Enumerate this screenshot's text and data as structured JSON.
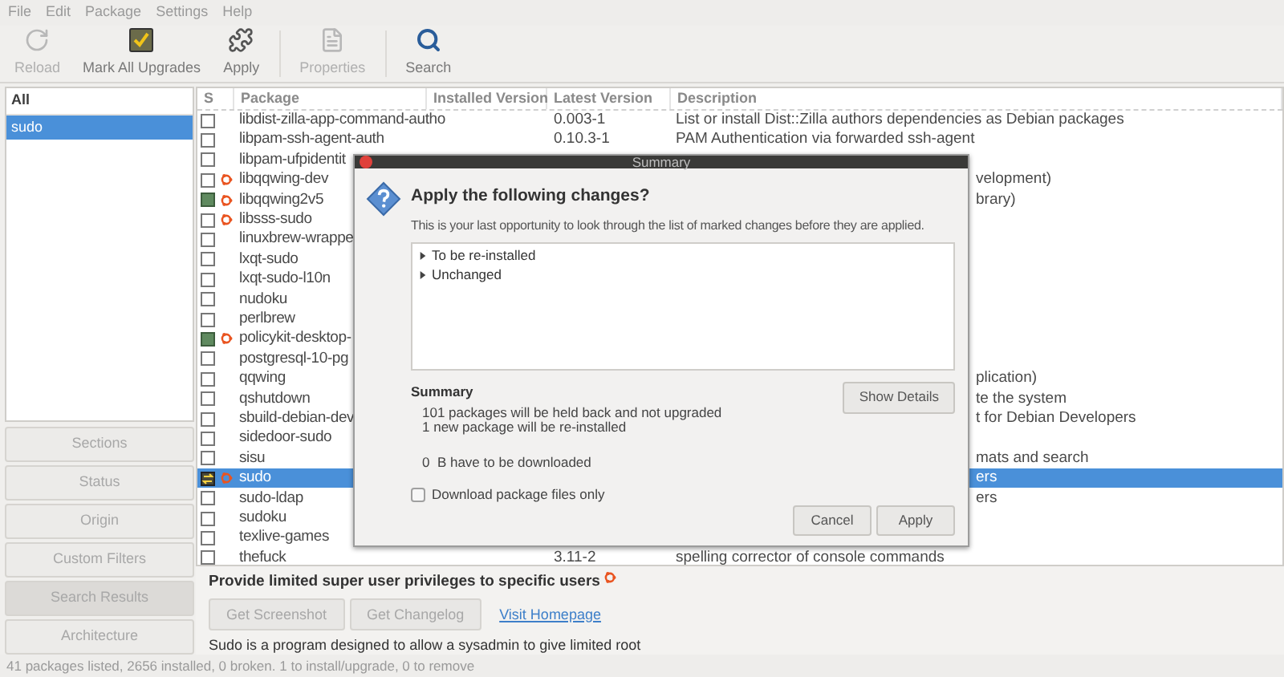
{
  "menu": [
    "File",
    "Edit",
    "Package",
    "Settings",
    "Help"
  ],
  "toolbar": [
    [
      {
        "label": "Reload",
        "kind": "reload",
        "disabled": true
      },
      {
        "label": "Mark All Upgrades",
        "kind": "mark",
        "disabled": false
      },
      {
        "label": "Apply",
        "kind": "apply",
        "disabled": false
      }
    ],
    [
      {
        "label": "Properties",
        "kind": "properties",
        "disabled": true
      }
    ],
    [
      {
        "label": "Search",
        "kind": "search",
        "disabled": false
      }
    ]
  ],
  "filter_list": {
    "header": "All",
    "items": [
      {
        "label": "sudo",
        "selected": true
      }
    ]
  },
  "filter_buttons": [
    {
      "label": "Sections",
      "selected": false
    },
    {
      "label": "Status",
      "selected": false
    },
    {
      "label": "Origin",
      "selected": false
    },
    {
      "label": "Custom Filters",
      "selected": false
    },
    {
      "label": "Search Results",
      "selected": true
    },
    {
      "label": "Architecture",
      "selected": false
    }
  ],
  "table": {
    "columns": [
      "S",
      "Package",
      "Installed Version",
      "Latest Version",
      "Description"
    ],
    "rows": [
      {
        "package": "libdist-zilla-app-command-autho",
        "kind": "none",
        "supported": false,
        "selected": false,
        "latest": "0.003-1",
        "description": "List or install Dist::Zilla authors dependencies as Debian packages"
      },
      {
        "package": "libpam-ssh-agent-auth",
        "kind": "none",
        "supported": false,
        "selected": false,
        "latest": "0.10.3-1",
        "description": "PAM Authentication via forwarded ssh-agent"
      },
      {
        "package": "libpam-ufpidentit",
        "kind": "none",
        "supported": false,
        "selected": false
      },
      {
        "package": "libqqwing-dev",
        "kind": "none",
        "supported": true,
        "selected": false,
        "description": "velopment)",
        "description_covered": true
      },
      {
        "package": "libqqwing2v5",
        "kind": "installed",
        "supported": true,
        "selected": false,
        "description": "brary)",
        "description_covered": true
      },
      {
        "package": "libsss-sudo",
        "kind": "none",
        "supported": true,
        "selected": false
      },
      {
        "package": "linuxbrew-wrappe",
        "kind": "none",
        "supported": false,
        "selected": false
      },
      {
        "package": "lxqt-sudo",
        "kind": "none",
        "supported": false,
        "selected": false
      },
      {
        "package": "lxqt-sudo-l10n",
        "kind": "none",
        "supported": false,
        "selected": false
      },
      {
        "package": "nudoku",
        "kind": "none",
        "supported": false,
        "selected": false
      },
      {
        "package": "perlbrew",
        "kind": "none",
        "supported": false,
        "selected": false
      },
      {
        "package": "policykit-desktop-",
        "kind": "installed",
        "supported": true,
        "selected": false
      },
      {
        "package": "postgresql-10-pg",
        "kind": "none",
        "supported": false,
        "selected": false
      },
      {
        "package": "qqwing",
        "kind": "none",
        "supported": false,
        "selected": false,
        "description": "plication)",
        "description_covered": true
      },
      {
        "package": "qshutdown",
        "kind": "none",
        "supported": false,
        "selected": false,
        "description": "te the system",
        "description_covered": true
      },
      {
        "package": "sbuild-debian-dev",
        "kind": "none",
        "supported": false,
        "selected": false,
        "description": "t for Debian Developers",
        "description_covered": true
      },
      {
        "package": "sidedoor-sudo",
        "kind": "none",
        "supported": false,
        "selected": false
      },
      {
        "package": "sisu",
        "kind": "none",
        "supported": false,
        "selected": false,
        "description": "mats and search",
        "description_covered": true
      },
      {
        "package": "sudo",
        "kind": "reinstall",
        "supported": true,
        "selected": true,
        "description": "ers",
        "description_covered": true
      },
      {
        "package": "sudo-ldap",
        "kind": "none",
        "supported": false,
        "selected": false,
        "description": "ers",
        "description_covered": true
      },
      {
        "package": "sudoku",
        "kind": "none",
        "supported": false,
        "selected": false
      },
      {
        "package": "texlive-games",
        "kind": "none",
        "supported": false,
        "selected": false
      },
      {
        "package": "thefuck",
        "kind": "none",
        "supported": false,
        "selected": false,
        "latest": "3.11-2",
        "description": "spelling corrector of console commands"
      }
    ]
  },
  "details": {
    "title": "Provide limited super user privileges to specific users",
    "supported": true,
    "buttons": [
      "Get Screenshot",
      "Get Changelog"
    ],
    "link": "Visit Homepage",
    "text": "Sudo is a program designed to allow a sysadmin to give limited root"
  },
  "status_bar": "41 packages listed, 2656 installed, 0 broken. 1 to install/upgrade, 0 to remove",
  "dialog": {
    "title": "Summary",
    "heading": "Apply the following changes?",
    "subtitle": "This is your last opportunity to look through the list of marked changes before they are applied.",
    "tree": [
      {
        "label": "To be re-installed",
        "expanded": false
      },
      {
        "label": "Unchanged",
        "expanded": false
      }
    ],
    "summary_title": "Summary",
    "summary_lines": [
      "101 packages will be held back and not upgraded",
      "1 new package will be re-installed"
    ],
    "download": "0  B have to be downloaded",
    "checkbox": {
      "label": "Download package files only",
      "checked": false
    },
    "details_button": "Show Details",
    "buttons": [
      "Cancel",
      "Apply"
    ]
  }
}
